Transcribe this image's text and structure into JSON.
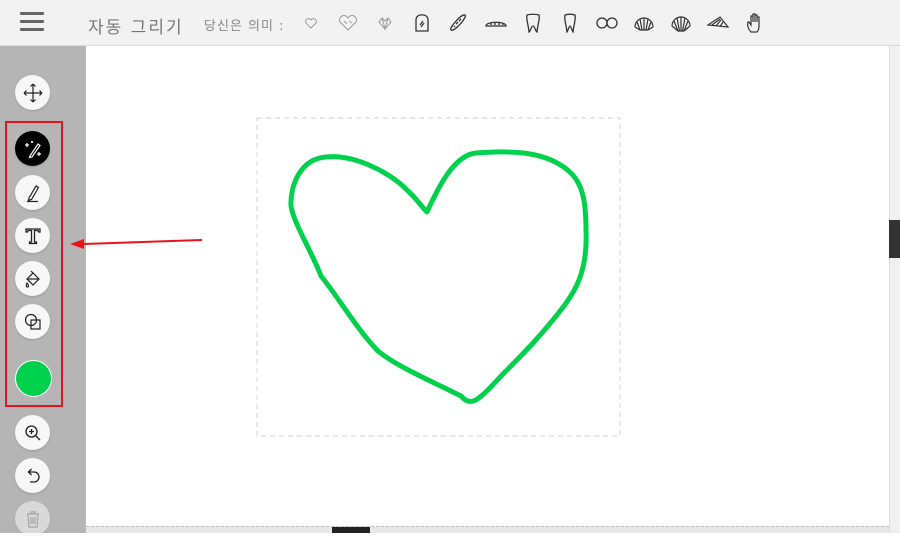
{
  "header": {
    "title": "자동 그리기",
    "suggest_label": "당신은 의미 :",
    "suggestions": [
      {
        "icon": "heart-small-icon"
      },
      {
        "icon": "heart-sketch-icon"
      },
      {
        "icon": "diamond-heart-icon"
      },
      {
        "icon": "toast-icon"
      },
      {
        "icon": "baguette-icon"
      },
      {
        "icon": "bread-loaf-icon"
      },
      {
        "icon": "tooth-icon"
      },
      {
        "icon": "tooth-outline-icon"
      },
      {
        "icon": "double-circle-icon"
      },
      {
        "icon": "seashell-icon"
      },
      {
        "icon": "scallop-shell-icon"
      },
      {
        "icon": "conch-shell-icon"
      },
      {
        "icon": "hand-icon"
      }
    ]
  },
  "toolbar": {
    "tools": [
      {
        "name": "move-tool",
        "icon": "move-icon"
      },
      {
        "name": "autodraw-tool",
        "icon": "magic-pencil-icon",
        "active": true
      },
      {
        "name": "draw-tool",
        "icon": "pencil-icon"
      },
      {
        "name": "type-tool",
        "icon": "text-icon"
      },
      {
        "name": "fill-tool",
        "icon": "paint-bucket-icon"
      },
      {
        "name": "shape-tool",
        "icon": "shapes-icon"
      }
    ],
    "current_color": "#00d14d",
    "actions": [
      {
        "name": "zoom-button",
        "icon": "zoom-in-icon"
      },
      {
        "name": "undo-button",
        "icon": "undo-icon"
      },
      {
        "name": "delete-button",
        "icon": "trash-icon"
      }
    ]
  },
  "canvas": {
    "drawing": "heart-sketch",
    "stroke_color": "#00d14d",
    "selection": "dashed-bounding-box"
  },
  "annotations": {
    "highlight_color": "#e8141b",
    "arrow_color": "#e8141b"
  }
}
